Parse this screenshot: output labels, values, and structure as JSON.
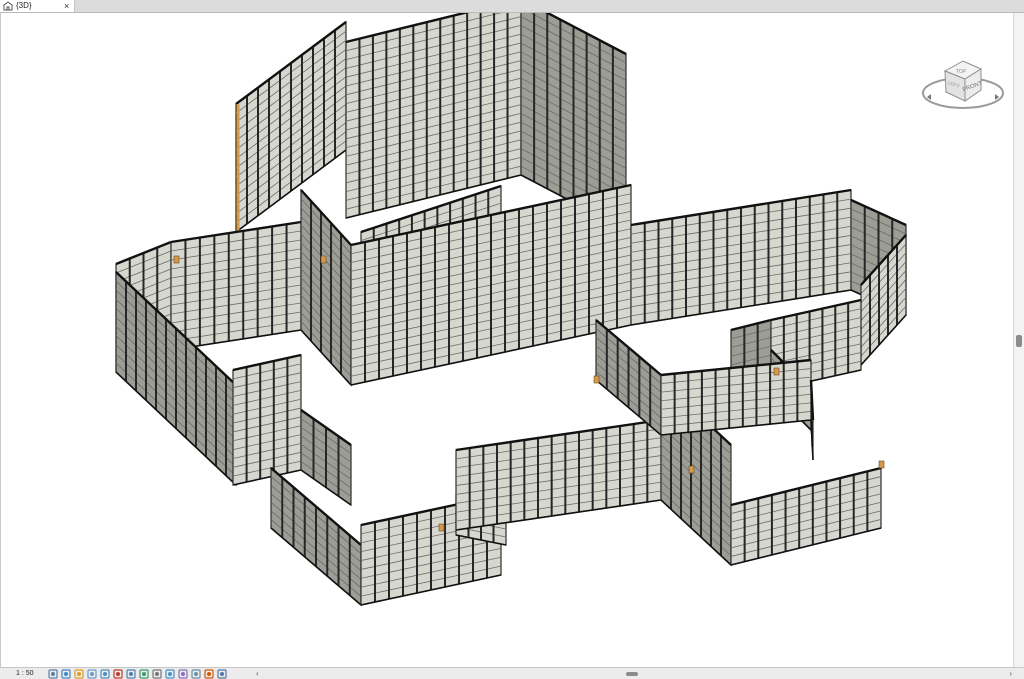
{
  "tab": {
    "label": "{3D}",
    "close": "×"
  },
  "viewcube": {
    "face_front": "FRONT",
    "face_top": "TOP",
    "face_left": "LEFT"
  },
  "status": {
    "scale": "1 : 50"
  },
  "colors": {
    "panel_fill": "#d7d7cf",
    "panel_line": "#2c2c2c",
    "rib_fill": "#8f8f8f",
    "accent": "#d49a4a"
  },
  "icons": [
    "detail-level-icon",
    "visual-style-icon",
    "sun-path-icon",
    "shadows-icon",
    "render-icon",
    "crop-view-icon",
    "show-crop-icon",
    "unlock-3d-icon",
    "temporary-hide-icon",
    "reveal-hidden-icon",
    "worksharing-icon",
    "design-options-icon",
    "analysis-icon",
    "highlight-displacement-icon"
  ]
}
